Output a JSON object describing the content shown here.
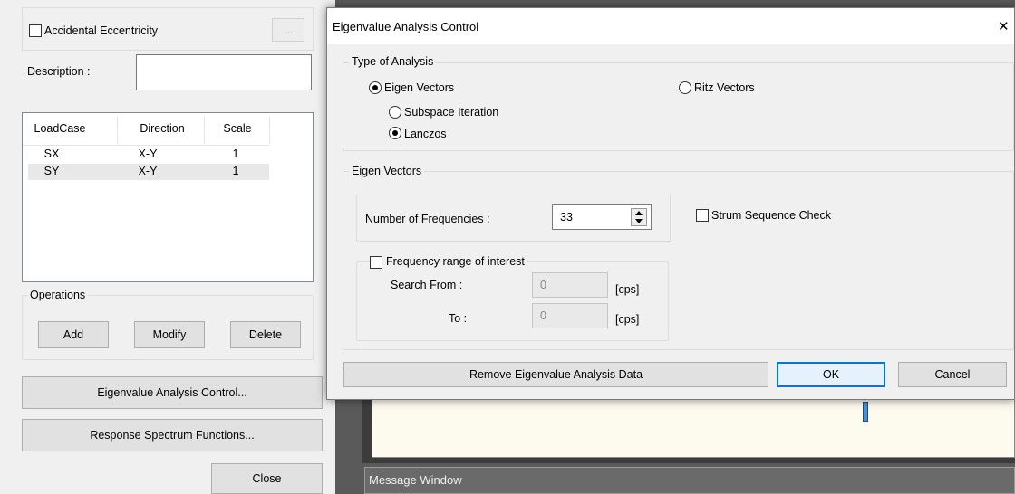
{
  "left_panel": {
    "accidental_eccentricity_label": "Accidental Eccentricity",
    "ellipsis_label": "...",
    "description_label": "Description :",
    "description_value": "",
    "table": {
      "headers": [
        "LoadCase",
        "Direction",
        "Scale"
      ],
      "rows": [
        {
          "loadcase": "SX",
          "direction": "X-Y",
          "scale": "1"
        },
        {
          "loadcase": "SY",
          "direction": "X-Y",
          "scale": "1"
        }
      ]
    },
    "operations_label": "Operations",
    "add_label": "Add",
    "modify_label": "Modify",
    "delete_label": "Delete",
    "eigen_control_label": "Eigenvalue Analysis Control...",
    "response_spectrum_label": "Response Spectrum Functions...",
    "close_label": "Close"
  },
  "background": {
    "message_window_label": "Message Window"
  },
  "dialog": {
    "title": "Eigenvalue Analysis Control",
    "close_glyph": "✕",
    "type_of_analysis": {
      "legend": "Type of Analysis",
      "eigen_vectors_label": "Eigen Vectors",
      "ritz_vectors_label": "Ritz Vectors",
      "subspace_label": "Subspace Iteration",
      "lanczos_label": "Lanczos",
      "selected_type": "Eigen Vectors",
      "selected_method": "Lanczos"
    },
    "eigen_vectors": {
      "legend": "Eigen Vectors",
      "num_freq_label": "Number of Frequencies :",
      "num_freq_value": "33",
      "strum_label": "Strum Sequence Check",
      "freq_range_label": "Frequency range of interest",
      "search_from_label": "Search From :",
      "search_from_value": "0",
      "to_label": "To :",
      "to_value": "0",
      "unit": "[cps]"
    },
    "remove_label": "Remove Eigenvalue Analysis Data",
    "ok_label": "OK",
    "cancel_label": "Cancel"
  },
  "colors": {
    "accent": "#0078d7",
    "background_dark": "#5a5a5a",
    "message_bar": "#6a6a6a",
    "highlight_row": "#e8e8e8"
  }
}
